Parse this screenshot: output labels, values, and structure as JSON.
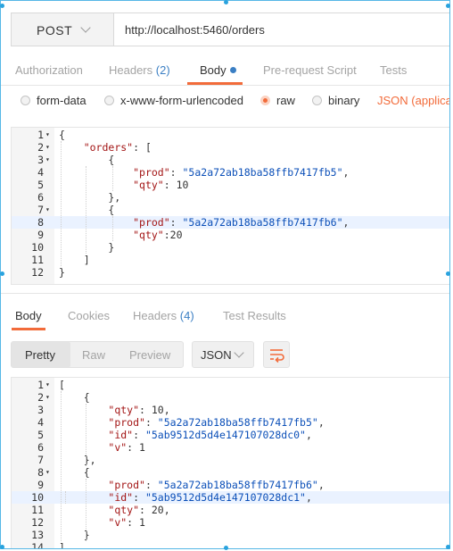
{
  "request": {
    "method": "POST",
    "url": "http://localhost:5460/orders"
  },
  "tabs": {
    "authorization": "Authorization",
    "headers": "Headers",
    "headers_count": "(2)",
    "body": "Body",
    "prerequest": "Pre-request Script",
    "tests": "Tests"
  },
  "body_types": {
    "form_data": "form-data",
    "urlencoded": "x-www-form-urlencoded",
    "raw": "raw",
    "binary": "binary",
    "content_type": "JSON (applicatio"
  },
  "request_editor": {
    "lines": [
      {
        "n": "1",
        "code": "{"
      },
      {
        "n": "2",
        "code": "    \"orders\": ["
      },
      {
        "n": "3",
        "code": "        {"
      },
      {
        "n": "4",
        "code": "            \"prod\": \"5a2a72ab18ba58ffb7417fb5\","
      },
      {
        "n": "5",
        "code": "            \"qty\": 10"
      },
      {
        "n": "6",
        "code": "        },"
      },
      {
        "n": "7",
        "code": "        {"
      },
      {
        "n": "8",
        "code": "            \"prod\": \"5a2a72ab18ba58ffb7417fb6\","
      },
      {
        "n": "9",
        "code": "            \"qty\":20"
      },
      {
        "n": "10",
        "code": "        }"
      },
      {
        "n": "11",
        "code": "    ]"
      },
      {
        "n": "12",
        "code": "}"
      }
    ]
  },
  "response_tabs": {
    "body": "Body",
    "cookies": "Cookies",
    "headers": "Headers",
    "headers_count": "(4)",
    "test_results": "Test Results"
  },
  "view_modes": {
    "pretty": "Pretty",
    "raw": "Raw",
    "preview": "Preview",
    "format": "JSON"
  },
  "response_editor": {
    "lines": [
      {
        "n": "1",
        "code": "["
      },
      {
        "n": "2",
        "code": "    {"
      },
      {
        "n": "3",
        "code": "        \"qty\": 10,"
      },
      {
        "n": "4",
        "code": "        \"prod\": \"5a2a72ab18ba58ffb7417fb5\","
      },
      {
        "n": "5",
        "code": "        \"id\": \"5ab9512d5d4e147107028dc0\","
      },
      {
        "n": "6",
        "code": "        \"v\": 1"
      },
      {
        "n": "7",
        "code": "    },"
      },
      {
        "n": "8",
        "code": "    {"
      },
      {
        "n": "9",
        "code": "        \"prod\": \"5a2a72ab18ba58ffb7417fb6\","
      },
      {
        "n": "10",
        "code": "        \"id\": \"5ab9512d5d4e147107028dc1\","
      },
      {
        "n": "11",
        "code": "        \"qty\": 20,"
      },
      {
        "n": "12",
        "code": "        \"v\": 1"
      },
      {
        "n": "13",
        "code": "    }"
      },
      {
        "n": "14",
        "code": "]"
      }
    ]
  },
  "colors": {
    "accent": "#f26b3a",
    "link": "#3b7fc4",
    "key": "#a31515",
    "string": "#0b4fb8",
    "selection_border": "#55b7e6"
  },
  "icons": {
    "method_dropdown": "chevron-down-icon",
    "format_dropdown": "chevron-down-icon",
    "wrap": "wrap-lines-icon",
    "fold": "fold-arrow-icon"
  }
}
